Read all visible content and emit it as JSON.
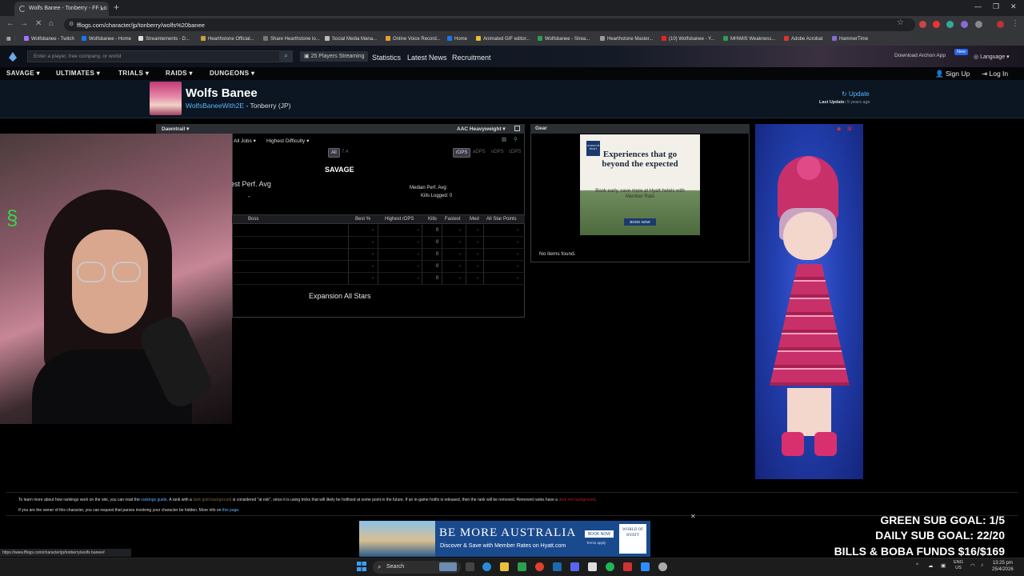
{
  "browser": {
    "tab_title": "Wolfs Banee - Tonberry - FF Lo",
    "url": "fflogs.com/character/jp/tonberry/wolfs%20banee",
    "status_url": "https://www.fflogs.com/character/jp/tonberry/wolfs banee#",
    "bookmarks": [
      "Wolfsbanee - Twitch",
      "Wolfsbanee - Home",
      "Streamlements - D...",
      "Hearthstone Official...",
      "Share Hearthstone lo...",
      "Social Media Mana...",
      "Online Voice Record...",
      "Home",
      "Animated GIF editor...",
      "Wolfsbanee - Strea...",
      "Hearthstone Master...",
      "(10) Wolfsbanee - Y...",
      "MHWilS Weakness...",
      "Adobe Acrobat",
      "HammerTime"
    ]
  },
  "site": {
    "search_placeholder": "Enter a player, free company, or world",
    "streaming": "25 Players Streaming",
    "links": [
      "Statistics",
      "Latest News",
      "Recruitment"
    ],
    "download_app": "Download Archon App",
    "new_badge": "New",
    "language": "Language",
    "nav": [
      "SAVAGE",
      "ULTIMATES",
      "TRIALS",
      "RAIDS",
      "DUNGEONS"
    ],
    "sign_up": "Sign Up",
    "log_in": "Log In"
  },
  "character": {
    "name": "Wolfs Banee",
    "subtitle_link": "WolfsBaneeWith2E",
    "subtitle_rest": " - Tonberry (JP)",
    "update": "Update",
    "last_update_label": "Last Update:",
    "last_update_value": "5 years ago"
  },
  "rankings": {
    "expansion": "Dawntrail",
    "zone": "AAC Heavyweight",
    "jobs_filter": "All Jobs",
    "difficulty": "Highest Difficulty",
    "partition_all": "All",
    "partition_ver": "7.4",
    "metrics": [
      "rDPS",
      "aDPS",
      "nDPS",
      "cDPS"
    ],
    "section_title": "SAVAGE",
    "best_perf_label": "est Perf. Avg",
    "best_perf_value": "-",
    "median_label": "Median Perf. Avg:",
    "kills_logged_label": "Kills Logged:",
    "kills_logged_value": "0",
    "columns": [
      "Boss",
      "Best %",
      "Highest rDPS",
      "Kills",
      "Fastest",
      "Med",
      "All Star Points"
    ],
    "rows": [
      {
        "best": "-",
        "rdps": "-",
        "kills": "0",
        "fastest": "-",
        "med": "-",
        "asp": "-"
      },
      {
        "best": "-",
        "rdps": "-",
        "kills": "0",
        "fastest": "-",
        "med": "-",
        "asp": "-"
      },
      {
        "best": "-",
        "rdps": "-",
        "kills": "0",
        "fastest": "-",
        "med": "-",
        "asp": "-"
      },
      {
        "best": "-",
        "rdps": "-",
        "kills": "0",
        "fastest": "-",
        "med": "-",
        "asp": "-"
      },
      {
        "best": "-",
        "rdps": "-",
        "kills": "0",
        "fastest": "-",
        "med": "-",
        "asp": "-"
      }
    ],
    "all_stars_title": "Expansion All Stars"
  },
  "gear": {
    "title": "Gear",
    "empty": "No items found.",
    "ad": {
      "logo": "WORLD OF HYATT",
      "headline": "Experiences that go beyond the expected",
      "body": "Book early, save more at Hyatt hotels with Member Rate",
      "button": "BOOK NOW"
    }
  },
  "footer": {
    "line1_a": "To learn more about how rankings work on the site, you can read the ",
    "line1_link": "rankings guide",
    "line1_b": ". A rank with a ",
    "line1_gold": "dark gold background",
    "line1_c": " is considered \"at risk\", since it is using tricks that will likely be hotfixed at some point in the future. If an in-game hotfix is released, then the rank will be removed. Removed ranks have a ",
    "line1_red": "dark red background",
    "line1_d": ".",
    "line2_a": "If you are the owner of this character, you can request that parses involving your character be hidden. More info on ",
    "line2_link": "this page",
    "line2_b": "."
  },
  "bottom_ad": {
    "headline": "BE MORE AUSTRALIA",
    "sub": "Discover & Save with Member Rates on Hyatt.com",
    "book": "BOOK NOW",
    "terms": "Terms apply",
    "logo": "WORLD OF HYATT"
  },
  "stream_overlay": {
    "green_goal": "GREEN SUB GOAL: 1/5",
    "daily_goal": "DAILY SUB GOAL: 22/20",
    "funds": "BILLS & BOBA FUNDS $16/$169"
  },
  "taskbar": {
    "search": "Search",
    "lang_top": "ENG",
    "lang_bottom": "US",
    "time": "13:25 pm",
    "date": "25/4/2026"
  }
}
